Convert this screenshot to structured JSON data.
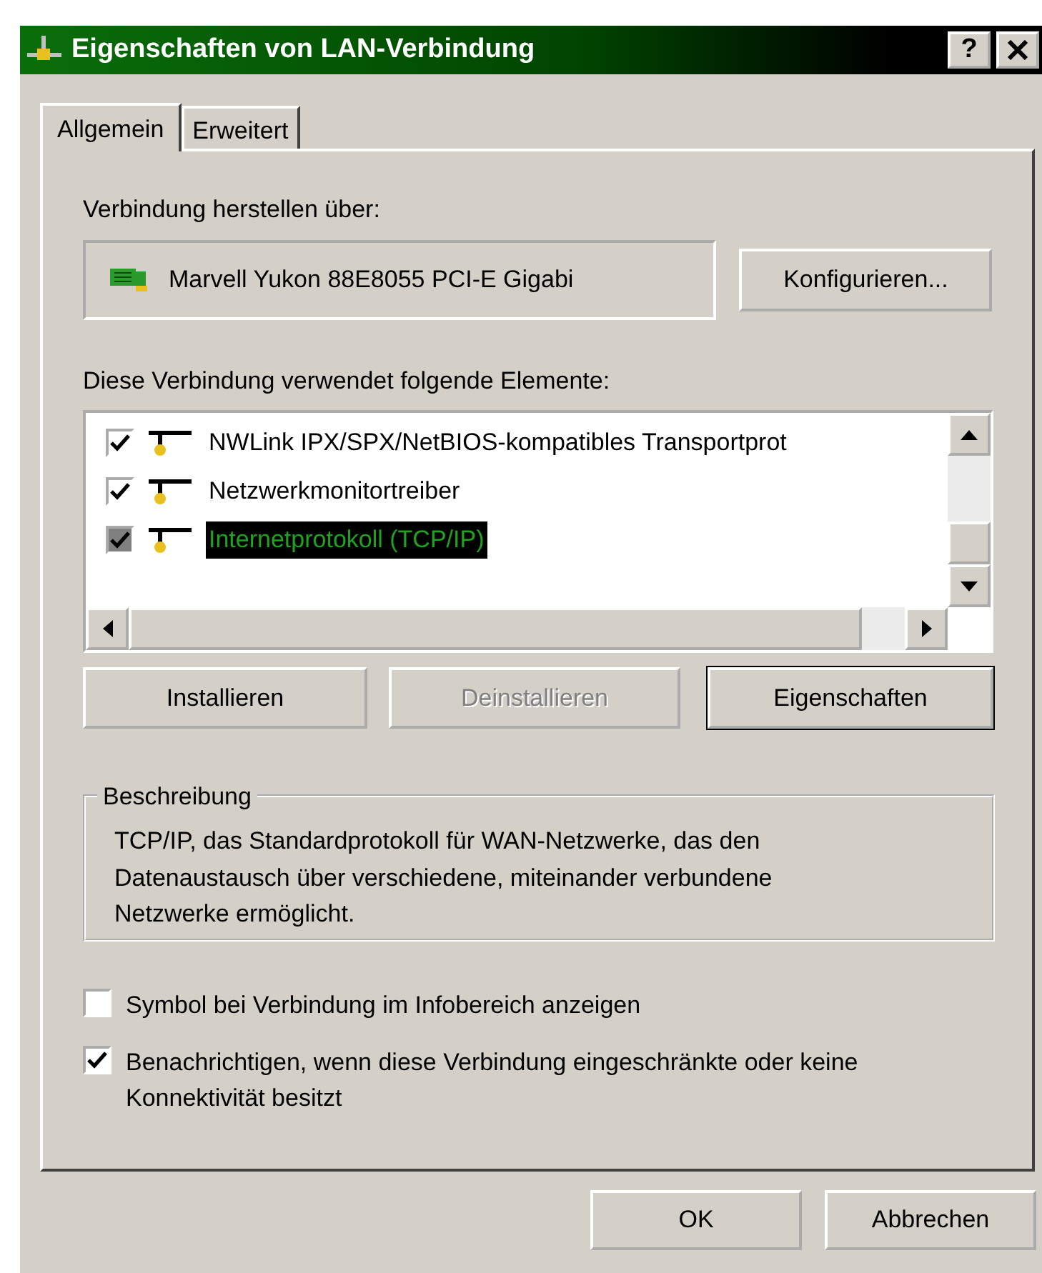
{
  "window": {
    "title": "Eigenschaften von LAN-Verbindung",
    "help_button": "?"
  },
  "tabs": [
    {
      "label": "Allgemein",
      "selected": true
    },
    {
      "label": "Erweitert",
      "selected": false
    }
  ],
  "connect_via": {
    "label": "Verbindung herstellen über:",
    "adapter": "Marvell Yukon 88E8055 PCI-E Gigabi",
    "configure_button": "Konfigurieren..."
  },
  "components": {
    "label": "Diese Verbindung verwendet folgende Elemente:",
    "items": [
      {
        "name": "NWLink IPX/SPX/NetBIOS-kompatibles Transportprot",
        "checked": true,
        "selected": false
      },
      {
        "name": "Netzwerkmonitortreiber",
        "checked": true,
        "selected": false
      },
      {
        "name": "Internetprotokoll (TCP/IP)",
        "checked": true,
        "selected": true
      }
    ]
  },
  "component_buttons": [
    {
      "label": "Installieren",
      "disabled": false,
      "default": false
    },
    {
      "label": "Deinstallieren",
      "disabled": true,
      "default": false
    },
    {
      "label": "Eigenschaften",
      "disabled": false,
      "default": true
    }
  ],
  "description": {
    "title": "Beschreibung",
    "text": "TCP/IP, das Standardprotokoll für WAN-Netzwerke, das den Datenaustausch über verschiedene, miteinander verbundene Netzwerke ermöglicht."
  },
  "options": [
    {
      "label": "Symbol bei Verbindung im Infobereich anzeigen",
      "checked": false
    },
    {
      "label": "Benachrichtigen, wenn diese Verbindung eingeschränkte oder keine Konnektivität besitzt",
      "checked": true
    }
  ],
  "dialog_buttons": [
    {
      "label": "OK"
    },
    {
      "label": "Abbrechen"
    }
  ]
}
